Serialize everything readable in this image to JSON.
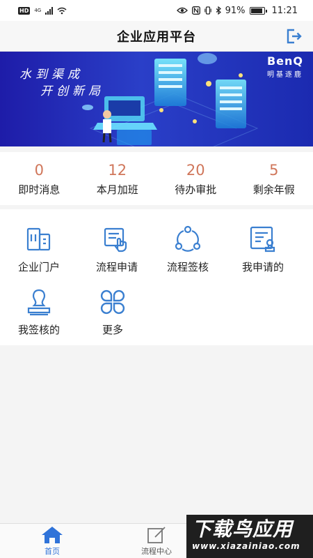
{
  "status_bar": {
    "network_badge": "HD",
    "network_type": "4G",
    "battery": "91%",
    "battery_level": 0.91,
    "time": "11:21"
  },
  "header": {
    "title": "企业应用平台",
    "logout_icon": "logout-icon"
  },
  "banner": {
    "slogan_line1": "水到渠成",
    "slogan_line2": "开创新局",
    "brand": "BenQ",
    "brand_sub": "明基逐鹿"
  },
  "stats": [
    {
      "value": "0",
      "label": "即时消息"
    },
    {
      "value": "12",
      "label": "本月加班"
    },
    {
      "value": "20",
      "label": "待办审批"
    },
    {
      "value": "5",
      "label": "剩余年假"
    }
  ],
  "apps": [
    {
      "label": "企业门户",
      "icon": "building-icon"
    },
    {
      "label": "流程申请",
      "icon": "hand-document-icon"
    },
    {
      "label": "流程签核",
      "icon": "cycle-icon"
    },
    {
      "label": "我申请的",
      "icon": "form-stamp-icon"
    },
    {
      "label": "我签核的",
      "icon": "seal-icon"
    },
    {
      "label": "更多",
      "icon": "more-grid-icon"
    }
  ],
  "tabbar": [
    {
      "label": "首页",
      "icon": "home-icon",
      "active": true
    },
    {
      "label": "流程中心",
      "icon": "edit-icon",
      "active": false
    },
    {
      "label": "",
      "icon": "",
      "active": false
    }
  ],
  "watermark": {
    "main": "下载鸟应用",
    "url": "www.xiazainiao.com"
  },
  "colors": {
    "accent": "#3a7fd0",
    "stat_number": "#d0765a",
    "banner_dark": "#1e1ca8"
  }
}
